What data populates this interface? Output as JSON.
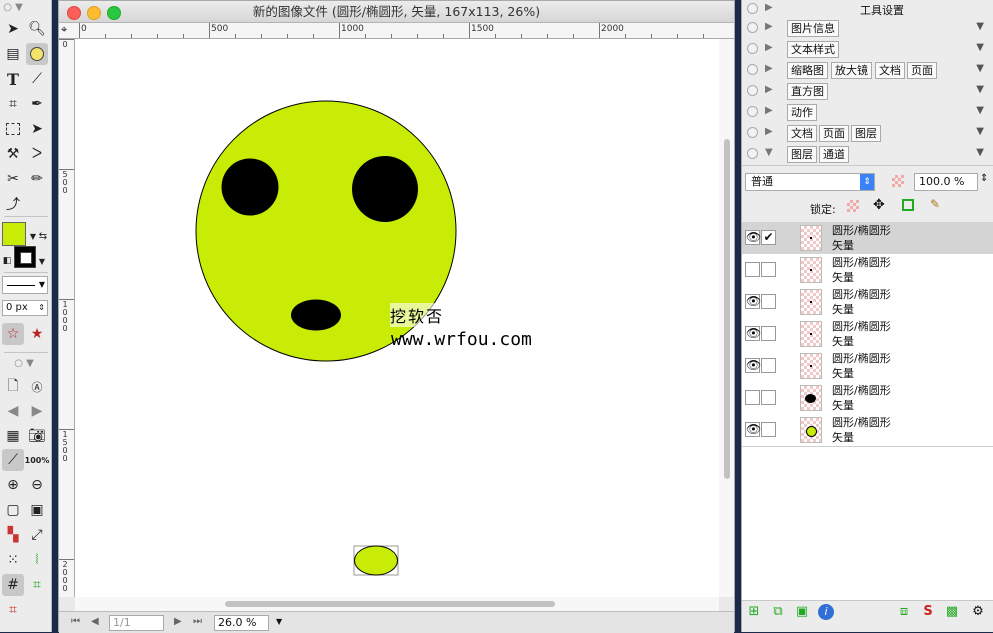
{
  "window": {
    "title": "新的图像文件 (圆形/椭圆形, 矢量, 167x113, 26%)"
  },
  "ruler": {
    "top_labels": [
      "0",
      "500",
      "1000",
      "1500",
      "2000"
    ],
    "left_labels": [
      "0",
      "500",
      "1000",
      "1500",
      "2000"
    ]
  },
  "canvas": {
    "watermark_line1": "挖软否",
    "watermark_line2": "www.wrfou.com",
    "fill_color": "#c8ec05",
    "stroke_color": "#000000"
  },
  "tools": {
    "foreground_color": "#c8ec05",
    "stroke_width": "0 px",
    "zoom_100": "100%"
  },
  "statusbar": {
    "page": "1/1",
    "zoom": "26.0 %"
  },
  "panel": {
    "title": "工具设置",
    "rows": [
      {
        "tabs": [
          "图片信息"
        ]
      },
      {
        "tabs": [
          "文本样式"
        ]
      },
      {
        "tabs": [
          "缩略图",
          "放大镜",
          "文档",
          "页面"
        ]
      },
      {
        "tabs": [
          "直方图"
        ]
      },
      {
        "tabs": [
          "动作"
        ]
      },
      {
        "tabs": [
          "文档",
          "页面",
          "图层"
        ]
      },
      {
        "tabs": [
          "图层",
          "通道"
        ]
      }
    ],
    "blend_mode": "普通",
    "opacity": "100.0 %",
    "lock_label": "锁定:",
    "layers": [
      {
        "name": "圆形/椭圆形",
        "type": "矢量",
        "visible": true,
        "checked": true,
        "selected": true
      },
      {
        "name": "圆形/椭圆形",
        "type": "矢量",
        "visible": false,
        "checked": false,
        "selected": false
      },
      {
        "name": "圆形/椭圆形",
        "type": "矢量",
        "visible": true,
        "checked": false,
        "selected": false
      },
      {
        "name": "圆形/椭圆形",
        "type": "矢量",
        "visible": true,
        "checked": false,
        "selected": false
      },
      {
        "name": "圆形/椭圆形",
        "type": "矢量",
        "visible": true,
        "checked": false,
        "selected": false
      },
      {
        "name": "圆形/椭圆形",
        "type": "矢量",
        "visible": false,
        "checked": false,
        "selected": false
      },
      {
        "name": "圆形/椭圆形",
        "type": "矢量",
        "visible": true,
        "checked": false,
        "selected": false
      }
    ]
  }
}
